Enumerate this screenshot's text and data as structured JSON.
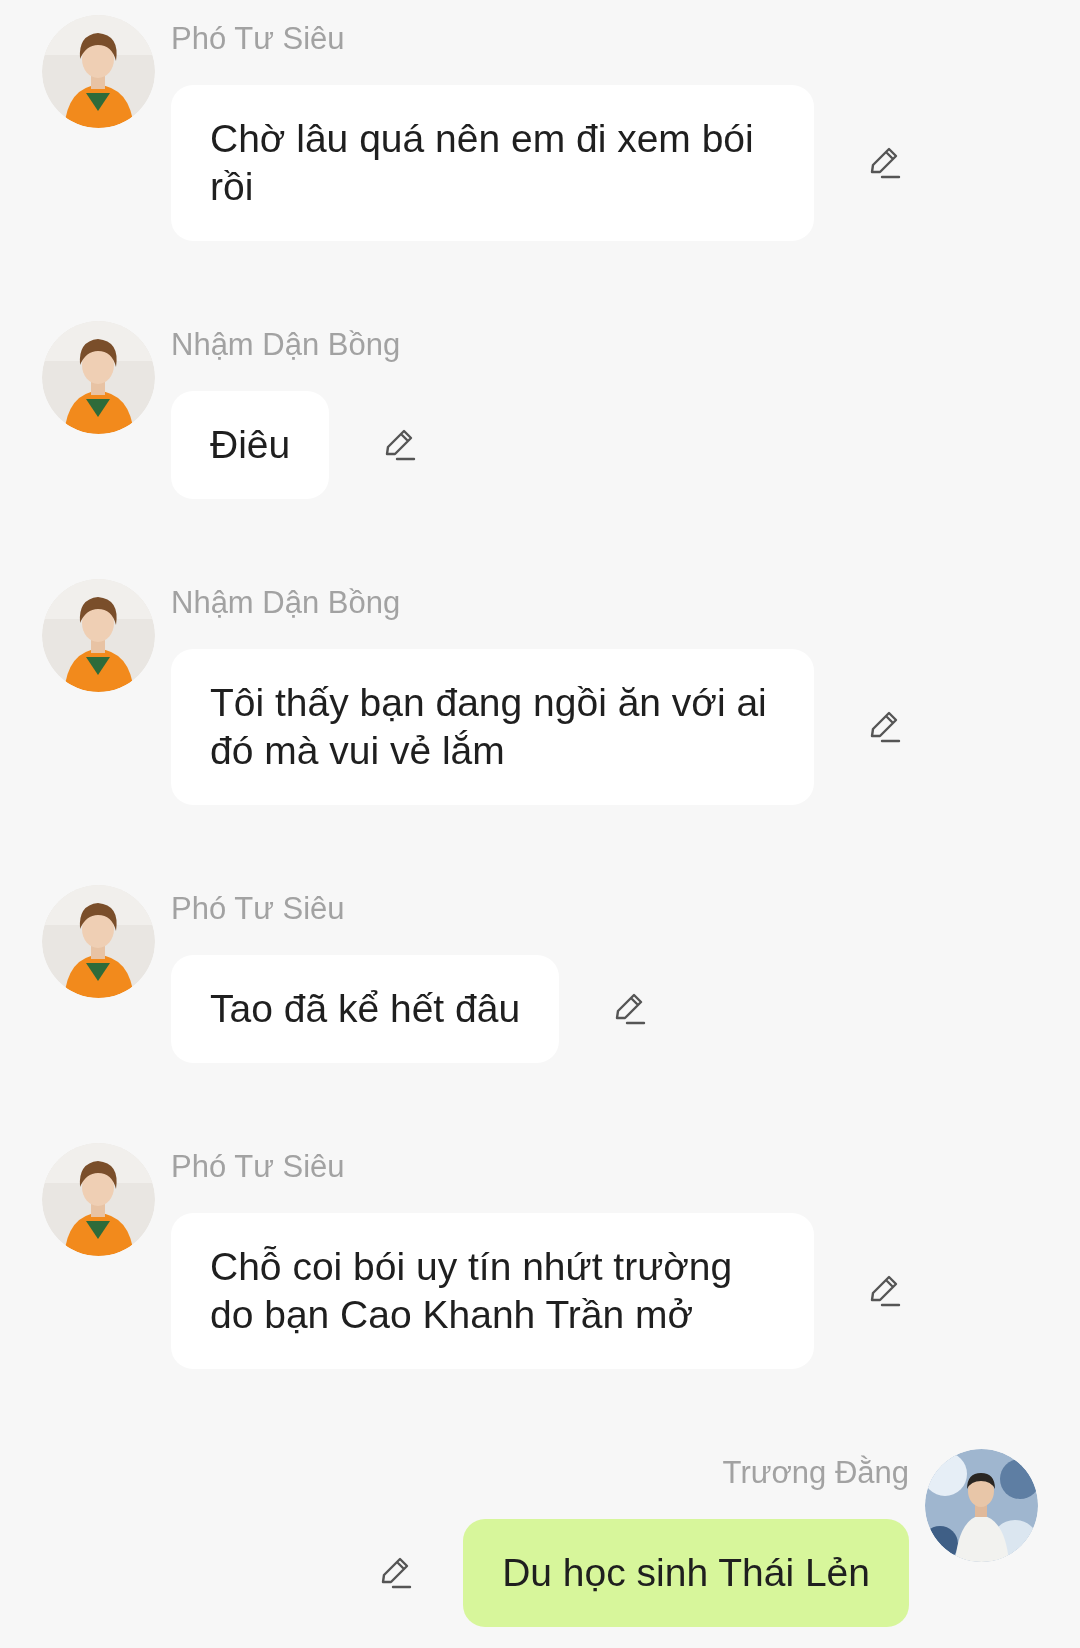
{
  "messages": [
    {
      "sender": "Phó Tư Siêu",
      "text": "Chờ lâu quá nên em đi xem bói rồi",
      "kind": "incoming"
    },
    {
      "sender": "Nhậm Dận Bồng",
      "text": "Điêu",
      "kind": "incoming"
    },
    {
      "sender": "Nhậm Dận Bồng",
      "text": "Tôi thấy bạn đang ngồi ăn với ai đó mà vui vẻ lắm",
      "kind": "incoming"
    },
    {
      "sender": "Phó Tư Siêu",
      "text": "Tao đã kể hết đâu",
      "kind": "incoming"
    },
    {
      "sender": "Phó Tư Siêu",
      "text": "Chỗ coi bói uy tín nhứt trường do bạn Cao Khanh Trần mở",
      "kind": "incoming"
    },
    {
      "sender": "Trương Đằng",
      "text": "Du học sinh Thái Lẻn",
      "kind": "outgoing"
    }
  ]
}
